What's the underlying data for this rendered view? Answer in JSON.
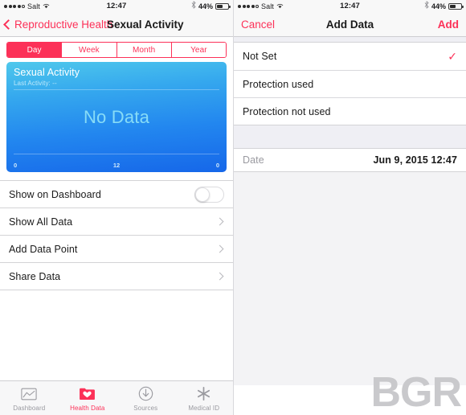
{
  "status_bar": {
    "carrier": "Salt",
    "time": "12:47",
    "battery_percent": "44%",
    "signal_dots_filled": 4,
    "signal_dots_total": 5,
    "wifi_icon": "wifi-icon",
    "bluetooth_icon": "bluetooth-icon"
  },
  "left_panel": {
    "nav": {
      "back_label": "Reproductive Health",
      "title": "Sexual Activity"
    },
    "segmented": {
      "options": [
        "Day",
        "Week",
        "Month",
        "Year"
      ],
      "selected": "Day"
    },
    "graph_card": {
      "title": "Sexual Activity",
      "subtitle": "Last Activity: --",
      "empty_message": "No Data",
      "axis_labels": [
        "0",
        "12",
        "0"
      ]
    },
    "rows": [
      {
        "label": "Show on Dashboard",
        "accessory": "toggle",
        "toggle_on": false
      },
      {
        "label": "Show All Data",
        "accessory": "chevron"
      },
      {
        "label": "Add Data Point",
        "accessory": "chevron"
      },
      {
        "label": "Share Data",
        "accessory": "chevron"
      }
    ],
    "tabs": [
      {
        "label": "Dashboard",
        "icon": "dashboard-chart-icon",
        "active": false
      },
      {
        "label": "Health Data",
        "icon": "health-data-folder-icon",
        "active": true
      },
      {
        "label": "Sources",
        "icon": "sources-download-icon",
        "active": false
      },
      {
        "label": "Medical ID",
        "icon": "medical-id-asterisk-icon",
        "active": false
      }
    ]
  },
  "right_panel": {
    "nav": {
      "cancel_label": "Cancel",
      "title": "Add Data",
      "add_label": "Add"
    },
    "options": [
      {
        "label": "Not Set",
        "selected": true
      },
      {
        "label": "Protection used",
        "selected": false
      },
      {
        "label": "Protection not used",
        "selected": false
      }
    ],
    "date_row": {
      "label": "Date",
      "value": "Jun 9, 2015   12:47"
    },
    "checkmark_glyph": "✓"
  },
  "watermark": "BGR",
  "colors": {
    "accent_red": "#fc3158",
    "card_gradient_top": "#4fc8ec",
    "card_gradient_bottom": "#1667e9",
    "no_data_text": "#87dcf7",
    "group_background": "#efeff4"
  }
}
